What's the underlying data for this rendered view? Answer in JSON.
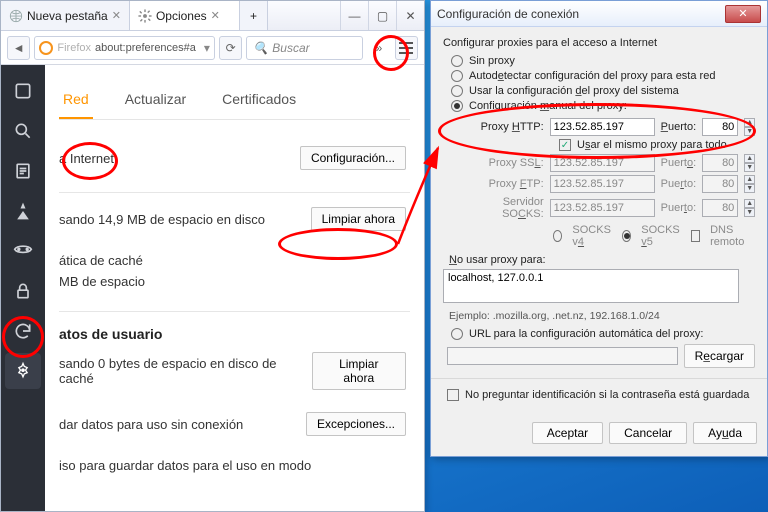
{
  "ff": {
    "tabs": {
      "newtab": "Nueva pestaña",
      "options": "Opciones"
    },
    "url": {
      "host": "Firefox",
      "rest": "about:preferences#a"
    },
    "search_placeholder": "Buscar",
    "content": {
      "tabs": {
        "net": "Red",
        "update": "Actualizar",
        "cert": "Certificados"
      },
      "row_internet": "a Internet",
      "btn_config": "Configuración...",
      "row_disk": "sando 14,9 MB de espacio en disco",
      "btn_clear": "Limpiar ahora",
      "row_cache1": "ática de caché",
      "row_cache2": "MB de espacio",
      "hdr_user": "atos de usuario",
      "row_user1": "sando 0 bytes de espacio en disco de caché",
      "row_user2": "dar datos para uso sin conexión",
      "btn_exc": "Excepciones...",
      "row_user3": "iso para guardar datos para el uso en modo"
    }
  },
  "dlg": {
    "title": "Configuración de conexión",
    "hdr": "Configurar proxies para el acceso a Internet",
    "r_none": "Sin proxy",
    "r_auto": "Autodetectar configuración del proxy para esta red",
    "r_sys": "Usar la configuración del proxy del sistema",
    "r_manual": "Configuración manual del proxy:",
    "lab_http": "Proxy HTTP:",
    "lab_ssl": "Proxy SSL:",
    "lab_ftp": "Proxy FTP:",
    "lab_socks": "Servidor SOCKS:",
    "lab_port": "Puerto:",
    "host": "123.52.85.197",
    "port": "80",
    "chk_same": "Usar el mismo proxy para todo",
    "socks4": "SOCKS v4",
    "socks5": "SOCKS v5",
    "dns": "DNS remoto",
    "noproxy_lab": "No usar proxy para:",
    "noproxy_val": "localhost, 127.0.0.1",
    "example": "Ejemplo: .mozilla.org, .net.nz, 192.168.1.0/24",
    "r_url": "URL para la configuración automática del proxy:",
    "btn_reload": "Recargar",
    "chk_ask": "No preguntar identificación si la contraseña está guardada",
    "btn_ok": "Aceptar",
    "btn_cancel": "Cancelar",
    "btn_help": "Ayuda"
  }
}
